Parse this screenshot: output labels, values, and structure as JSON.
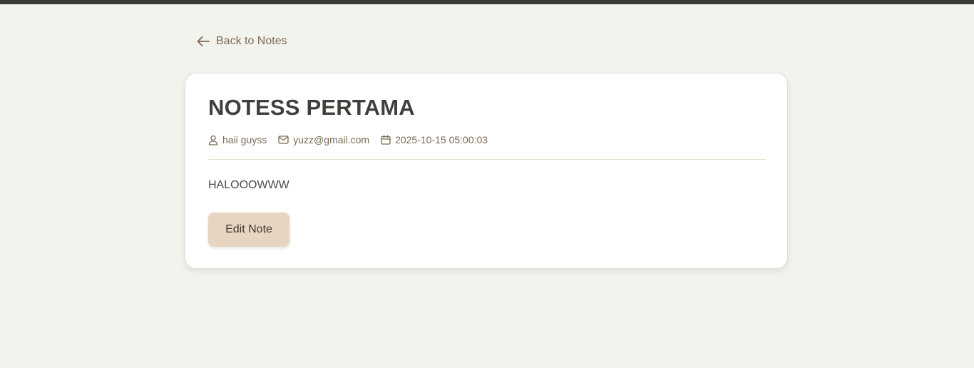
{
  "nav": {
    "back_label": "Back to Notes",
    "back_icon": "arrow-left-icon"
  },
  "note": {
    "title": "NOTESS PERTAMA",
    "author": "haii guyss",
    "email": "yuzz@gmail.com",
    "date": "2025-10-15 05:00:03",
    "content": "HALOOOWWW",
    "author_icon": "user-icon",
    "email_icon": "mail-icon",
    "date_icon": "calendar-icon"
  },
  "actions": {
    "edit_label": "Edit Note"
  },
  "colors": {
    "background": "#f3f3ee",
    "topbar": "#3a3a36",
    "accent_text": "#7c6a52",
    "button_bg": "#e6d6c1",
    "title_text": "#3f3f3c"
  }
}
